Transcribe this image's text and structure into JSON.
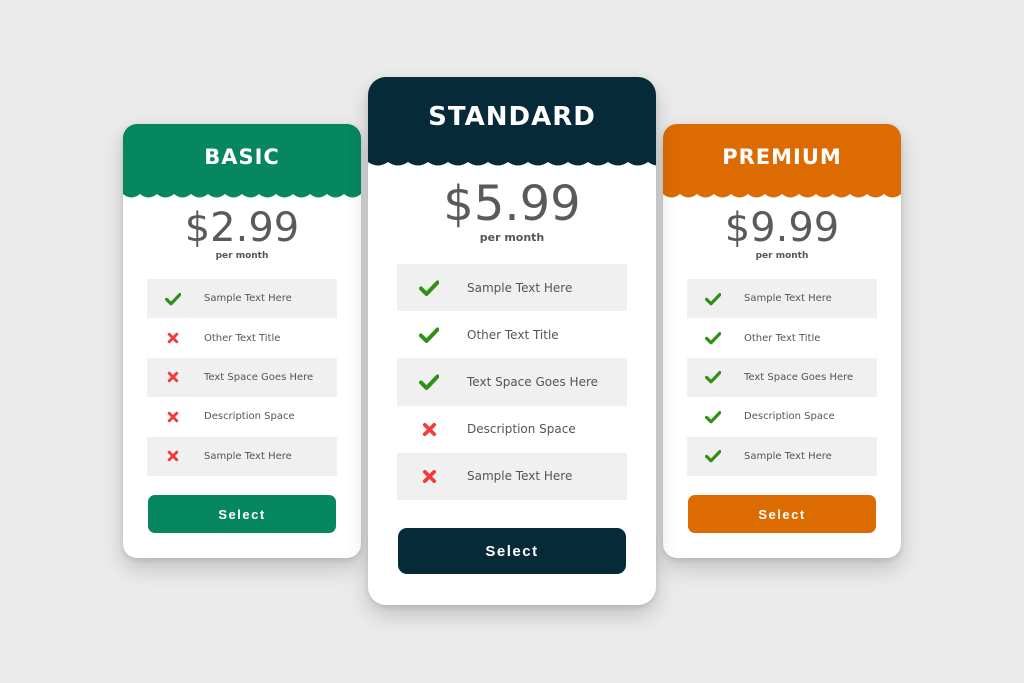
{
  "colors": {
    "background": "#ebebeb",
    "basic": "#068760",
    "standard": "#062a38",
    "premium": "#dc6b02",
    "check": "#2f9114",
    "cross": "#ef3e3e"
  },
  "plans": [
    {
      "id": "basic",
      "name": "BASIC",
      "price": "$2.99",
      "period": "per month",
      "features": [
        {
          "label": "Sample Text Here",
          "included": true,
          "icon": "check-icon"
        },
        {
          "label": "Other Text Title",
          "included": false,
          "icon": "cross-icon"
        },
        {
          "label": "Text Space Goes Here",
          "included": false,
          "icon": "cross-icon"
        },
        {
          "label": "Description Space",
          "included": false,
          "icon": "cross-icon"
        },
        {
          "label": "Sample Text Here",
          "included": false,
          "icon": "cross-icon"
        }
      ],
      "button_label": "Select"
    },
    {
      "id": "standard",
      "name": "STANDARD",
      "price": "$5.99",
      "period": "per month",
      "features": [
        {
          "label": "Sample Text Here",
          "included": true,
          "icon": "check-icon"
        },
        {
          "label": "Other Text Title",
          "included": true,
          "icon": "check-icon"
        },
        {
          "label": "Text Space Goes Here",
          "included": true,
          "icon": "check-icon"
        },
        {
          "label": "Description Space",
          "included": false,
          "icon": "cross-icon"
        },
        {
          "label": "Sample Text Here",
          "included": false,
          "icon": "cross-icon"
        }
      ],
      "button_label": "Select"
    },
    {
      "id": "premium",
      "name": "PREMIUM",
      "price": "$9.99",
      "period": "per month",
      "features": [
        {
          "label": "Sample Text Here",
          "included": true,
          "icon": "check-icon"
        },
        {
          "label": "Other Text Title",
          "included": true,
          "icon": "check-icon"
        },
        {
          "label": "Text Space Goes Here",
          "included": true,
          "icon": "check-icon"
        },
        {
          "label": "Description Space",
          "included": true,
          "icon": "check-icon"
        },
        {
          "label": "Sample Text Here",
          "included": true,
          "icon": "check-icon"
        }
      ],
      "button_label": "Select"
    }
  ]
}
